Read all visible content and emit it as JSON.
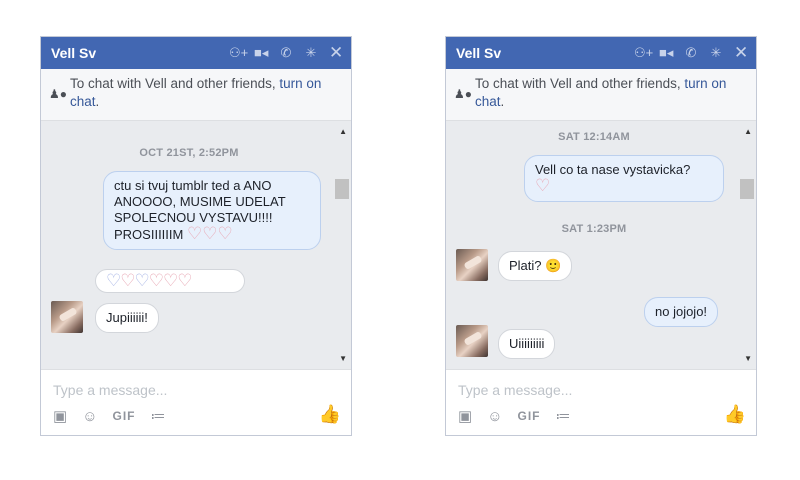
{
  "chats": [
    {
      "title": "Vell Sv",
      "notice_text": "To chat with Vell and other friends,",
      "notice_link": "turn on chat",
      "notice_end": ".",
      "composer_placeholder": "Type a message...",
      "gif_label": "GIF",
      "timestamps": [
        "OCT 21ST, 2:52PM"
      ],
      "messages": [
        {
          "from": "me",
          "text": "ctu si tvuj tumblr ted a ANO ANOOOO, MUSIME UDELAT SPOLECNOU VYSTAVU!!!! PROSIIIIIIM",
          "hearts": "♡♡♡"
        },
        {
          "from": "them",
          "text": "",
          "hearts": "♡♡♡♡♡♡"
        },
        {
          "from": "them",
          "text": "Jupiiiiii!",
          "hearts": ""
        }
      ]
    },
    {
      "title": "Vell Sv",
      "notice_text": "To chat with Vell and other friends,",
      "notice_link": "turn on chat",
      "notice_end": ".",
      "composer_placeholder": "Type a message...",
      "gif_label": "GIF",
      "timestamps": [
        "SAT 12:14AM",
        "SAT 1:23PM"
      ],
      "messages": [
        {
          "from": "me",
          "text": "Vell co ta nase vystavicka?",
          "hearts": "♡"
        },
        {
          "from": "them",
          "text": "Plati?",
          "emoji": "🙂"
        },
        {
          "from": "me",
          "text": "no jojojo!"
        },
        {
          "from": "them",
          "text": "Uiiiiiiiii"
        }
      ]
    }
  ],
  "icons": [
    "add-people-icon",
    "video-call-icon",
    "phone-icon",
    "settings-icon",
    "close-icon",
    "person-online-icon",
    "camera-icon",
    "emoji-icon",
    "attachment-icon",
    "thumbs-up-icon"
  ],
  "colors": {
    "header": "#4267b2",
    "my_bubble": "#e7f0fc",
    "their_bubble": "#ffffff",
    "link": "#365899"
  }
}
